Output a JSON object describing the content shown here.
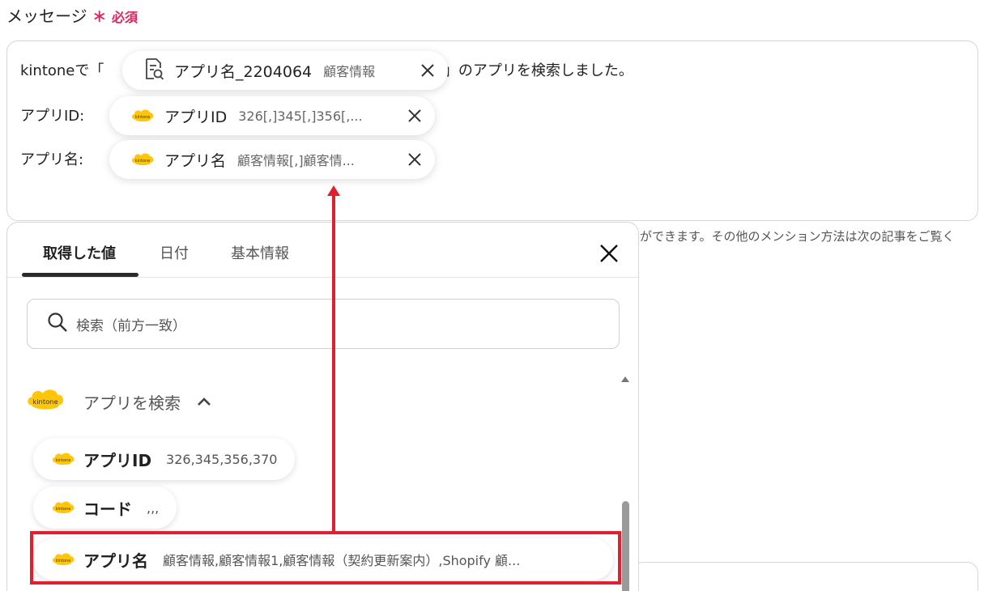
{
  "field": {
    "label": "メッセージ",
    "required_mark": "∗",
    "required_text": "必須"
  },
  "message": {
    "line1_prefix": "kintoneで「",
    "line1_suffix": "」のアプリを検索しました。",
    "line2_label": "アプリID:",
    "line3_label": "アプリ名:",
    "pill_search": {
      "icon": "document-search-icon",
      "name": "アプリ名_2204064",
      "value": "顧客情報"
    },
    "pill_appid": {
      "icon": "kintone-logo-icon",
      "name": "アプリID",
      "value": "326[,]345[,]356[,..."
    },
    "pill_appname": {
      "icon": "kintone-logo-icon",
      "name": "アプリ名",
      "value": "顧客情報[,]顧客情..."
    }
  },
  "hint": "ができます。その他のメンション方法は次の記事をご覧く",
  "dropdown": {
    "tabs": [
      "取得した値",
      "日付",
      "基本情報"
    ],
    "active_tab": "取得した値",
    "search_placeholder": "検索（前方一致）",
    "group_title": "アプリを検索",
    "items": [
      {
        "name": "アプリID",
        "value": "326,345,356,370"
      },
      {
        "name": "コード",
        "value": ",,,"
      },
      {
        "name": "アプリ名",
        "value": "顧客情報,顧客情報1,顧客情報（契約更新案内）,Shopify 顧..."
      }
    ]
  },
  "colors": {
    "required": "#e0245e",
    "highlight": "#e0202e",
    "kintone": "#ffc60b"
  }
}
